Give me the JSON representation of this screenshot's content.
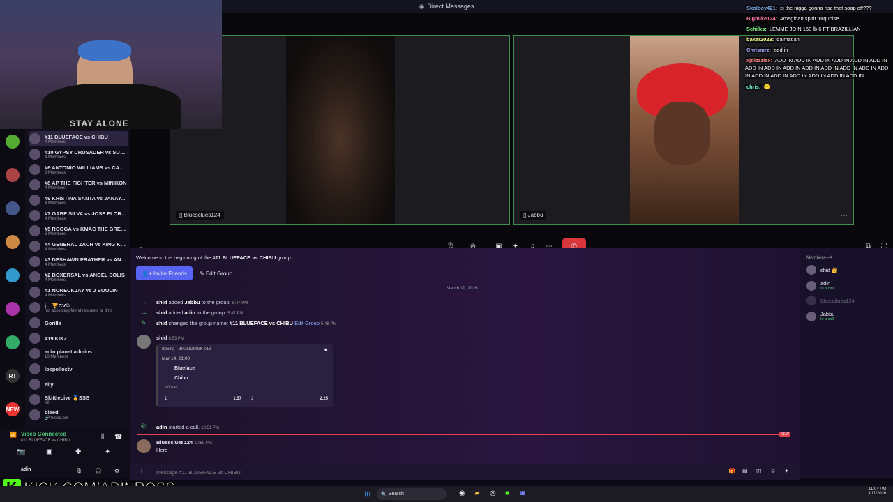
{
  "window": {
    "title": "Direct Messages"
  },
  "overlay_chat": [
    {
      "user": "Skolboy421:",
      "msg": "is the nigga gonna rise that soap off???",
      "color": "#7ad"
    },
    {
      "user": "Bigmike124:",
      "msg": "Amegiban spirit turquoise",
      "color": "#f7a"
    },
    {
      "user": "Schilks:",
      "msg": "LEMME JOIN 150 lb 6 FT BRAZILLIAN",
      "color": "#8f8"
    },
    {
      "user": "baker2023:",
      "msg": "dalmatian",
      "color": "#ff8"
    },
    {
      "user": "Chrismrz:",
      "msg": "add in",
      "color": "#aaf"
    },
    {
      "user": "xjdizzzlex:",
      "msg": "ADD IN ADD IN ADD IN ADD IN ADD IN ADD IN ADD IN ADD IN ADD IN ADD IN ADD IN ADD IN ADD IN ADD IN ADD IN ADD IN ADD IN ADD IN ADD IN ADD IN",
      "color": "#f88"
    },
    {
      "user": "chris:",
      "msg": "😶",
      "color": "#7fd"
    }
  ],
  "webcam": {
    "text": "STAY ALONE"
  },
  "dms": [
    {
      "name": "#11 BLUEFACE vs CHIBU",
      "sub": "4 Members",
      "active": true
    },
    {
      "name": "#10 GYPSY CRUSADER vs SUP...",
      "sub": "4 Members"
    },
    {
      "name": "#6 ANTONIO WILLIAMS vs CA...",
      "sub": "3 Members"
    },
    {
      "name": "#8 AP THE FIGHTER vs MINIKON",
      "sub": "4 Members"
    },
    {
      "name": "#9 KRISTINA SANTA vs JANAY...",
      "sub": "4 Members"
    },
    {
      "name": "#7 GABE SILVA vs JOSE FLORE...",
      "sub": "4 Members"
    },
    {
      "name": "#5 ROOGA vs KMAC THE GREAT",
      "sub": "6 Members"
    },
    {
      "name": "#4 GENERAL ZACH vs KING KE...",
      "sub": "4 Members"
    },
    {
      "name": "#3 DESHAWN PRATHER vs AN...",
      "sub": "4 Members"
    },
    {
      "name": "#2 BOXERSAL vs ANGEL SOLIS",
      "sub": "4 Members"
    },
    {
      "name": "#1 NONECKJAY vs J BOOLIN",
      "sub": "4 Members"
    },
    {
      "name": "j... 🏆CV©",
      "sub": "not accepting friend requests or dms"
    },
    {
      "name": "Gorilla",
      "sub": ""
    },
    {
      "name": "419 KIKZ",
      "sub": ""
    },
    {
      "name": "adin planet admins",
      "sub": "10 Members"
    },
    {
      "name": "lospollostv",
      "sub": ""
    },
    {
      "name": "elly",
      "sub": ""
    },
    {
      "name": "SkittleLive 🏅SSB",
      "sub": "#2"
    },
    {
      "name": "bleed",
      "sub": "🔗 bleed.bot"
    }
  ],
  "servers": [
    {
      "label": "",
      "color": "#5a3"
    },
    {
      "label": "",
      "color": "#a44",
      "badge": "46"
    },
    {
      "label": "",
      "color": "#458",
      "badge": "89"
    },
    {
      "label": "",
      "color": "#c84"
    },
    {
      "label": "",
      "color": "#39c"
    },
    {
      "label": "",
      "color": "#a3a"
    },
    {
      "label": "",
      "color": "#3a6"
    },
    {
      "label": "RT",
      "color": "#333"
    },
    {
      "label": "NEW",
      "color": "#e33"
    }
  ],
  "voice": {
    "status": "Video Connected",
    "channel": "#11 BLUEFACE vs CHIBU",
    "user": "adin",
    "user_status": "In a call"
  },
  "call": {
    "tile1": "Bluesclues124",
    "tile2": "Jabbu"
  },
  "chat": {
    "welcome_pre": "Welcome to the beginning of the ",
    "welcome_group": "#11 BLUEFACE vs CHIBU",
    "welcome_post": " group.",
    "invite": "Invite Friends",
    "edit": "Edit Group",
    "date": "March 11, 2026",
    "sys": [
      {
        "who": "shid",
        "text": "added",
        "target": "Jabbu",
        "rest": "to the group.",
        "time": "5:47 PM"
      },
      {
        "who": "shid",
        "text": "added",
        "target": "adin",
        "rest": "to the group.",
        "time": "5:47 PM"
      },
      {
        "who": "shid",
        "text": "changed the group name:",
        "target": "#11 BLUEFACE vs CHIBU",
        "rest": "Edit Group",
        "time": "5:48 PM"
      }
    ],
    "msg1": {
      "author": "shid",
      "time": "8:53 PM"
    },
    "bet": {
      "header": "Boxing · BRANDRISK 013",
      "date": "Mar 14, 21:00",
      "f1": "Blueface",
      "f2": "Chibu",
      "label": "Winner",
      "o1k": "1",
      "o1": "1.57",
      "o2k": "2",
      "o2": "2.25"
    },
    "call_msg": {
      "who": "adin",
      "text": "started a call.",
      "time": "10:51 PM"
    },
    "new_label": "NEW",
    "msg2": {
      "author": "Bluesclues124",
      "time": "10:59 PM",
      "text": "Here"
    },
    "input_placeholder": "Message #11 BLUEFACE vs CHIBU"
  },
  "members": {
    "title": "Members—4",
    "list": [
      {
        "name": "shid 👑",
        "status": ""
      },
      {
        "name": "adin",
        "status": "In a call"
      },
      {
        "name": "Bluesclues124",
        "status": "",
        "dim": true
      },
      {
        "name": "Jabbu",
        "status": "In a call"
      }
    ]
  },
  "kick": {
    "text": "KICK.COM/ADINROSS"
  },
  "taskbar": {
    "search": "Search",
    "time": "11:04 PM",
    "date": "3/11/2026"
  }
}
